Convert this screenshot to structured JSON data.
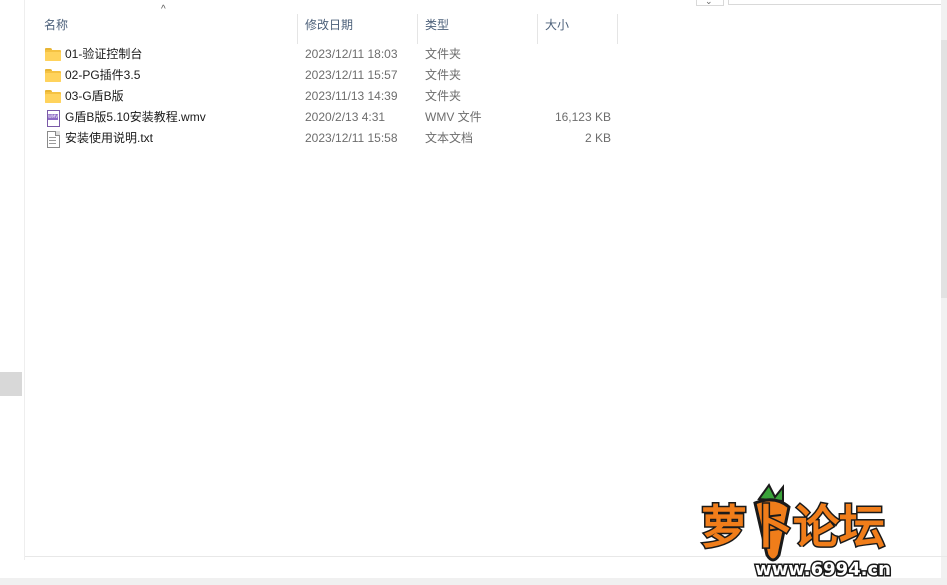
{
  "columns": {
    "name": "名称",
    "date": "修改日期",
    "type": "类型",
    "size": "大小"
  },
  "sort_indicator": "^",
  "files": [
    {
      "icon": "folder-icon",
      "name": "01-验证控制台",
      "date": "2023/12/11 18:03",
      "type": "文件夹",
      "size": ""
    },
    {
      "icon": "folder-icon",
      "name": "02-PG插件3.5",
      "date": "2023/12/11 15:57",
      "type": "文件夹",
      "size": ""
    },
    {
      "icon": "folder-icon",
      "name": "03-G盾B版",
      "date": "2023/11/13 14:39",
      "type": "文件夹",
      "size": ""
    },
    {
      "icon": "video-file-icon",
      "name": "G盾B版5.10安装教程.wmv",
      "date": "2020/2/13 4:31",
      "type": "WMV 文件",
      "size": "16,123 KB"
    },
    {
      "icon": "text-file-icon",
      "name": "安装使用说明.txt",
      "date": "2023/12/11 15:58",
      "type": "文本文档",
      "size": "2 KB"
    }
  ],
  "watermark": {
    "title": "萝卜论坛",
    "url": "www.6994.cn"
  },
  "colors": {
    "header_text": "#4c607a",
    "folder": "#f5c242",
    "watermark_orange": "#f07d1a",
    "watermark_text": "#1a1a1a"
  }
}
